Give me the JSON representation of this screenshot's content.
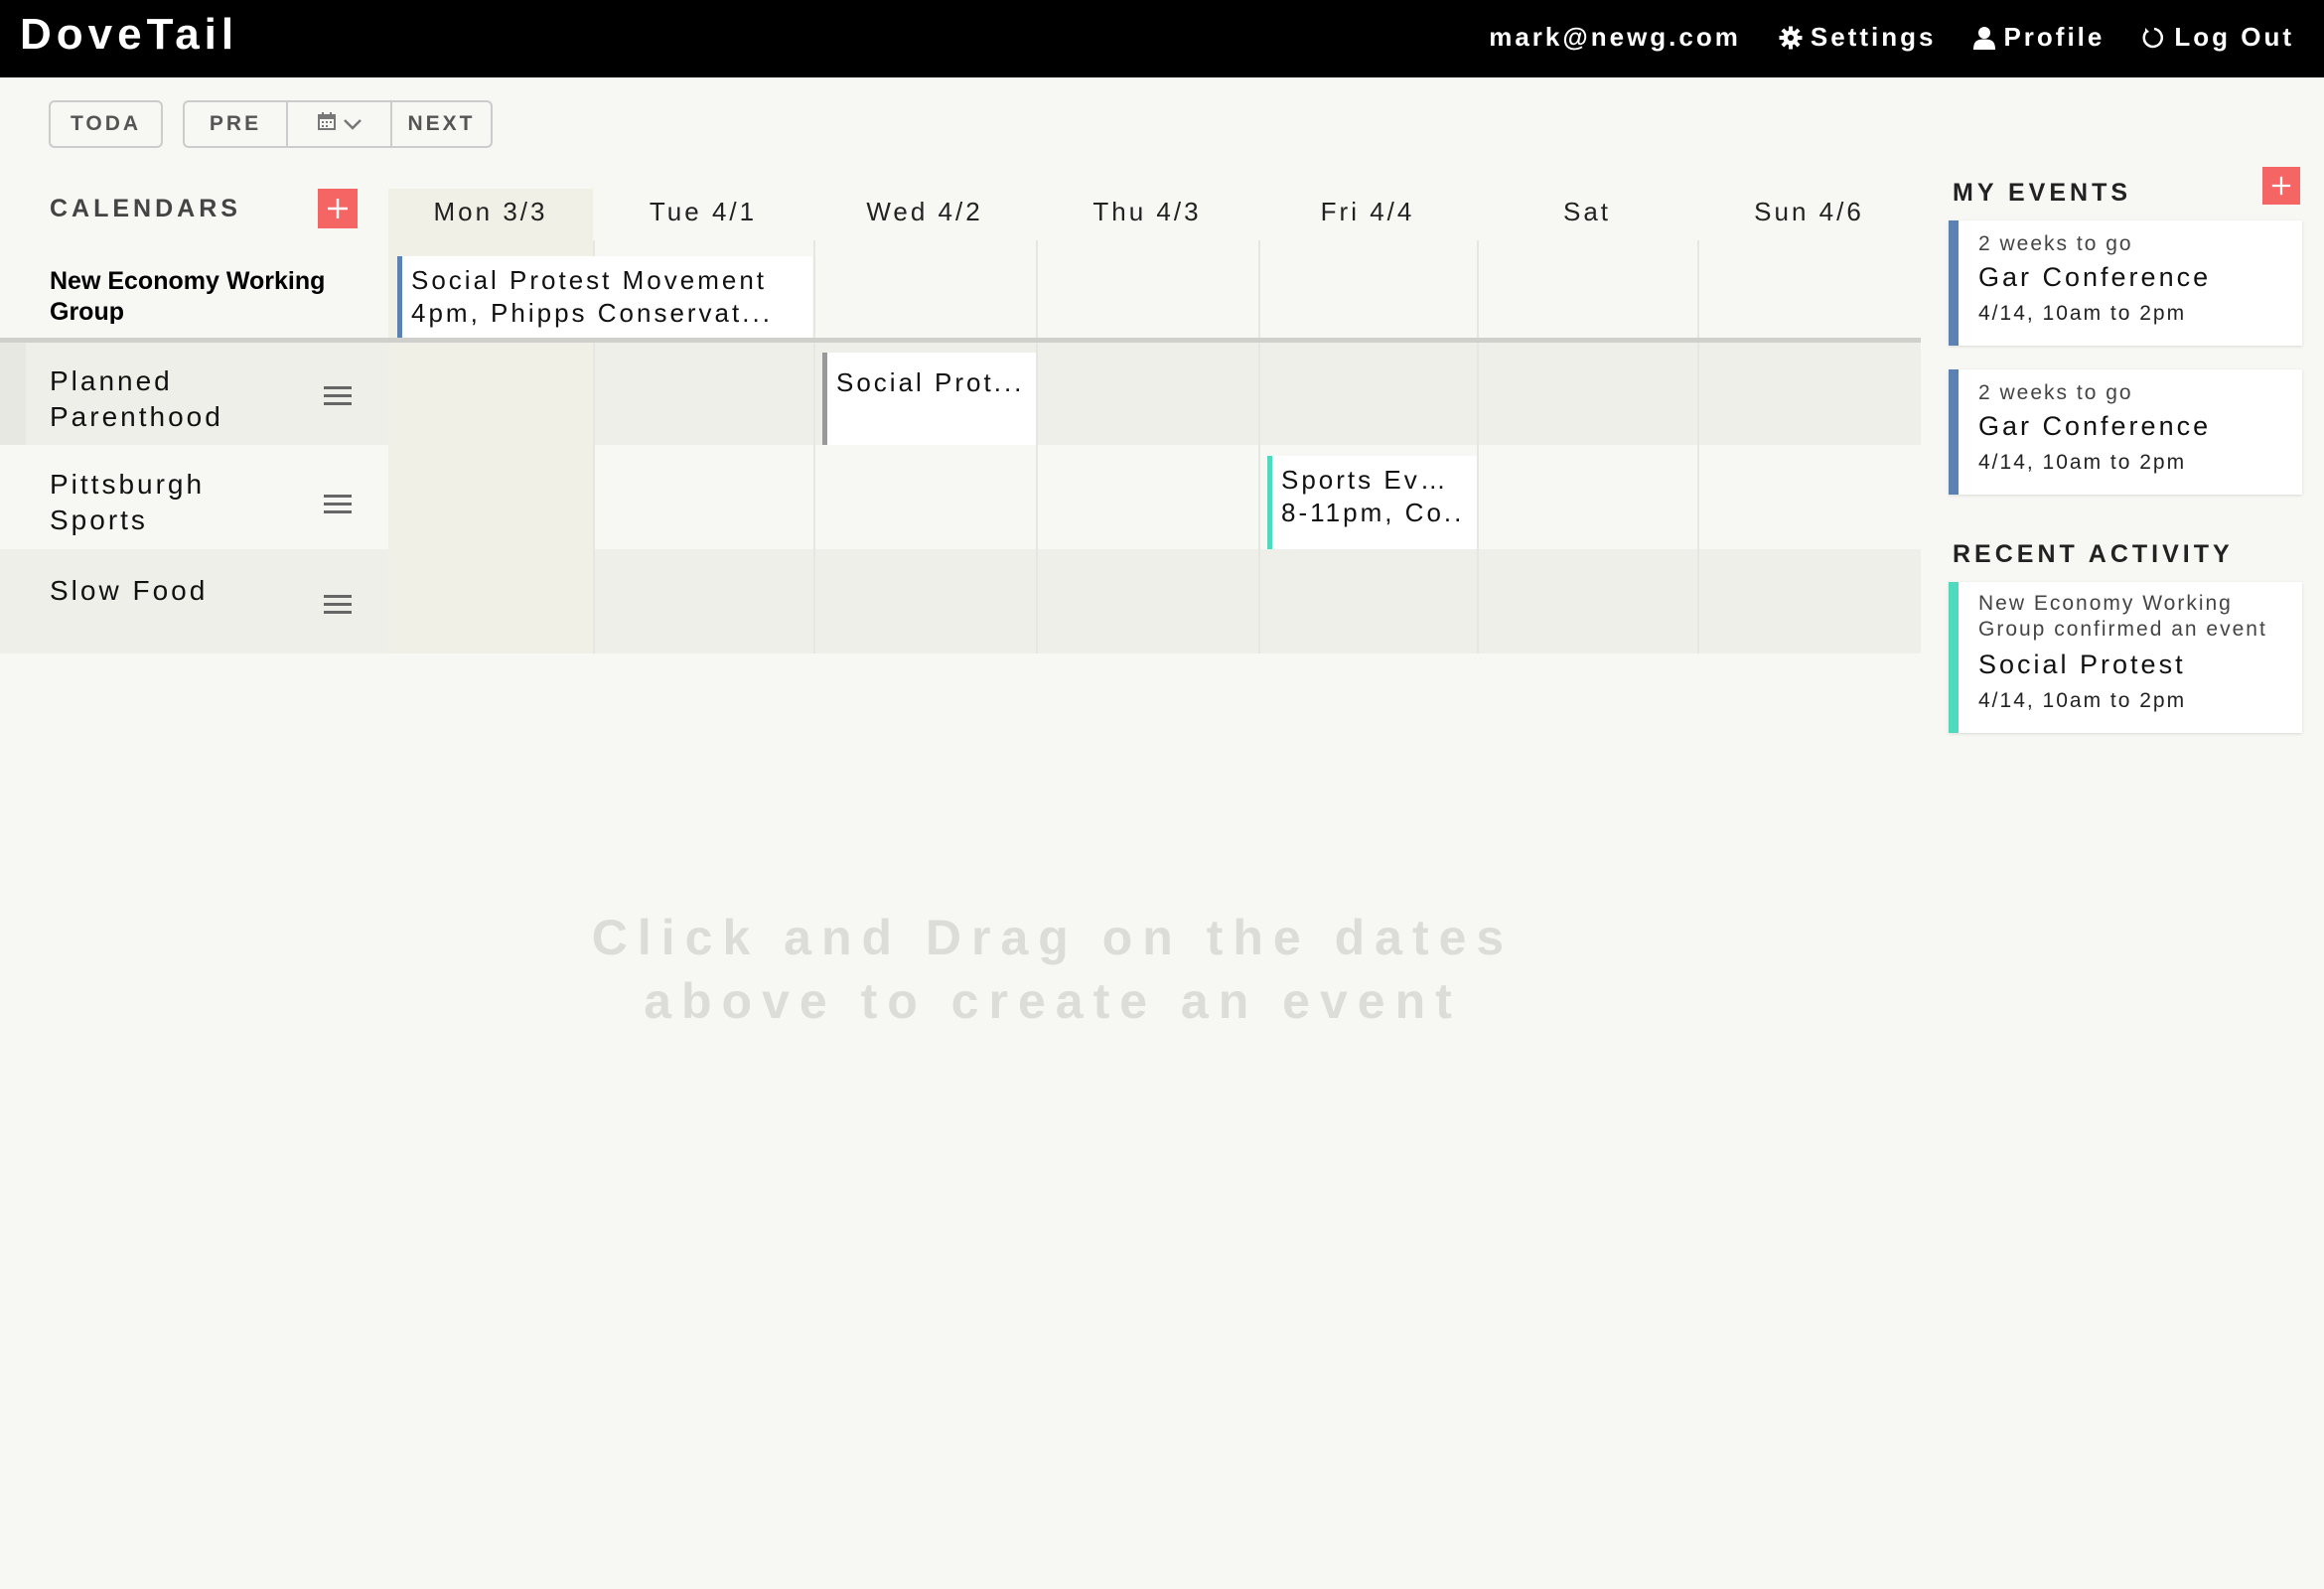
{
  "header": {
    "brand": "DoveTail",
    "email": "mark@newg.com",
    "settings": "Settings",
    "profile": "Profile",
    "logout": "Log Out"
  },
  "toolbar": {
    "today": "TODA",
    "prev": "PRE",
    "next": "NEXT"
  },
  "calendars": {
    "title": "CALENDARS",
    "group": "New Economy Working Group",
    "items": [
      {
        "name_line1": "Planned",
        "name_line2": "Parenthood"
      },
      {
        "name_line1": "Pittsburgh",
        "name_line2": "Sports"
      },
      {
        "name_line1": "Slow Food",
        "name_line2": ""
      }
    ]
  },
  "days": [
    "Mon 3/3",
    "Tue 4/1",
    "Wed 4/2",
    "Thu 4/3",
    "Fri 4/4",
    "Sat",
    "Sun 4/6"
  ],
  "events": [
    {
      "line1": "Social Protest Movement",
      "line2": "4pm, Phipps Conservat...",
      "color": "#5b82b3"
    },
    {
      "line1": "Social Prot...",
      "line2": "",
      "color": "#999999"
    },
    {
      "line1": "Sports Ev…",
      "line2": "8-11pm, Co..",
      "color": "#4fd9bd"
    }
  ],
  "placeholder": {
    "line1": "Click and Drag on the dates",
    "line2": "above to create an event"
  },
  "my_events": {
    "title": "MY EVENTS",
    "cards": [
      {
        "countdown": "2 weeks to go",
        "name": "Gar Conference",
        "time": "4/14, 10am to 2pm",
        "color": "#5b82b3"
      },
      {
        "countdown": "2 weeks to go",
        "name": "Gar Conference",
        "time": "4/14, 10am to 2pm",
        "color": "#5b82b3"
      }
    ]
  },
  "recent_activity": {
    "title": "RECENT ACTIVITY",
    "cards": [
      {
        "line1a": "New Economy Working",
        "line1b": "Group confirmed an event",
        "name": "Social Protest",
        "time": "4/14, 10am to 2pm",
        "color": "#4fd9bd"
      }
    ]
  },
  "colors": {
    "accent_red": "#f46564",
    "topbar": "#000000",
    "background": "#f7f7f3"
  },
  "icons": [
    "gear-icon",
    "user-icon",
    "power-icon",
    "calendar-icon",
    "chevron-down-icon",
    "plus-icon",
    "menu-icon"
  ]
}
